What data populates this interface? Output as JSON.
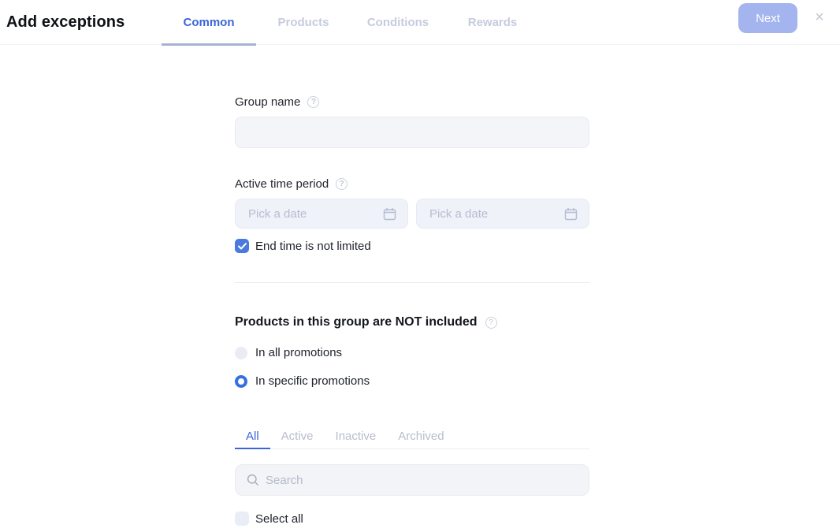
{
  "header": {
    "title": "Add exceptions",
    "tabs": [
      {
        "label": "Common",
        "active": true
      },
      {
        "label": "Products",
        "active": false
      },
      {
        "label": "Conditions",
        "active": false
      },
      {
        "label": "Rewards",
        "active": false
      }
    ],
    "next_button_label": "Next",
    "close_icon": "×"
  },
  "icons": {
    "help": "?",
    "search": "magnifier",
    "calendar": "calendar",
    "checkmark": "check"
  },
  "form": {
    "group_name": {
      "label": "Group name",
      "value": "",
      "placeholder": ""
    },
    "active_time_period": {
      "label": "Active time period",
      "start_date": {
        "value": "",
        "placeholder": "Pick a date"
      },
      "end_date": {
        "value": "",
        "placeholder": "Pick a date"
      },
      "end_not_limited": {
        "label": "End time is not limited",
        "checked": true
      }
    },
    "not_included": {
      "heading": "Products in this group are NOT included",
      "options": [
        {
          "label": "In all promotions",
          "selected": false
        },
        {
          "label": "In specific promotions",
          "selected": true
        }
      ]
    },
    "promotions_picker": {
      "tabs": [
        {
          "label": "All",
          "active": true
        },
        {
          "label": "Active",
          "active": false
        },
        {
          "label": "Inactive",
          "active": false
        },
        {
          "label": "Archived",
          "active": false
        }
      ],
      "search": {
        "value": "",
        "placeholder": "Search"
      },
      "select_all": {
        "label": "Select all",
        "checked": false
      }
    }
  },
  "colors": {
    "accent_blue": "#3c64d9",
    "control_blue": "#4a7ae0",
    "radio_blue": "#3570e3",
    "next_button_bg": "#a3b4ee",
    "inactive_tab": "#c6ccde",
    "active_tab_indicator": "#a7b1d3",
    "input_bg": "#f4f5f9",
    "date_input_bg": "#f0f2f9",
    "placeholder_text": "#b6bdd0"
  }
}
